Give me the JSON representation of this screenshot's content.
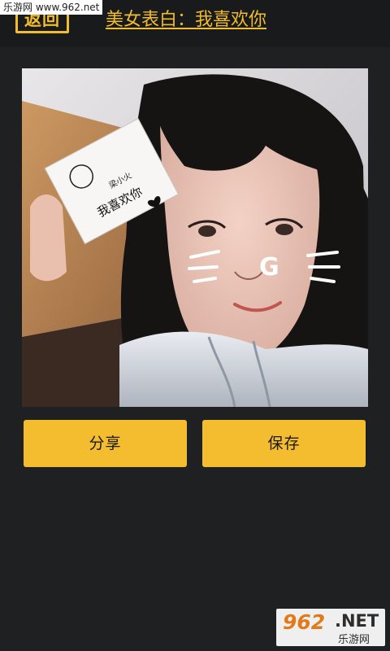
{
  "watermark": {
    "top_text": "乐游网 www.962.net",
    "logo_number": "962",
    "logo_domain": ".NET",
    "logo_caption": "乐游网"
  },
  "header": {
    "back_label": "返回",
    "title": "美女表白：我喜欢你"
  },
  "photo": {
    "card_text": "我喜欢你",
    "card_small_text": "梁小火",
    "face_doodle_letter": "G"
  },
  "actions": {
    "share_label": "分享",
    "save_label": "保存"
  },
  "colors": {
    "accent": "#f4bc2f",
    "background": "#1f2022",
    "header": "#191a1b"
  }
}
